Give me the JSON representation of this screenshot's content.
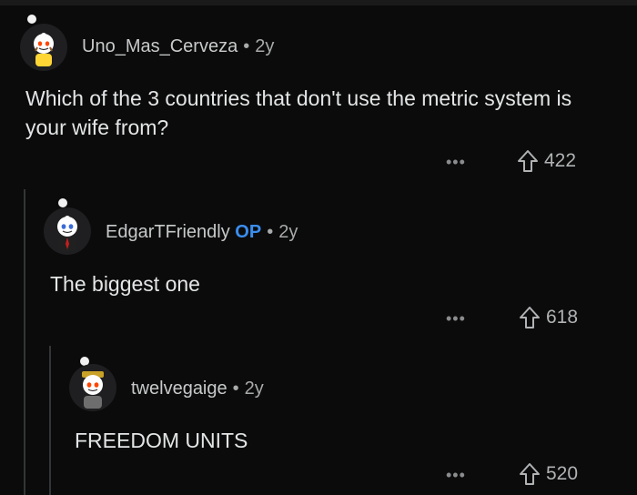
{
  "comments": [
    {
      "username": "Uno_Mas_Cerveza",
      "op_badge": "",
      "separator": "•",
      "age": "2y",
      "text": "Which of the 3 countries that don't use the metric system is your wife from?",
      "more": "•••",
      "upvotes": "422",
      "avatar": "snoo-avatar-yellow-shirt"
    },
    {
      "username": "EdgarTFriendly",
      "op_badge": "OP",
      "separator": "•",
      "age": "2y",
      "text": "The biggest one",
      "more": "•••",
      "upvotes": "618",
      "avatar": "snoo-avatar-suit"
    },
    {
      "username": "twelvegaige",
      "op_badge": "",
      "separator": "•",
      "age": "2y",
      "text": "FREEDOM UNITS",
      "more": "•••",
      "upvotes": "520",
      "avatar": "snoo-avatar-hat"
    }
  ],
  "colors": {
    "background": "#0b0b0b",
    "op_badge": "#3a8eef",
    "thread_line": "#343536"
  }
}
